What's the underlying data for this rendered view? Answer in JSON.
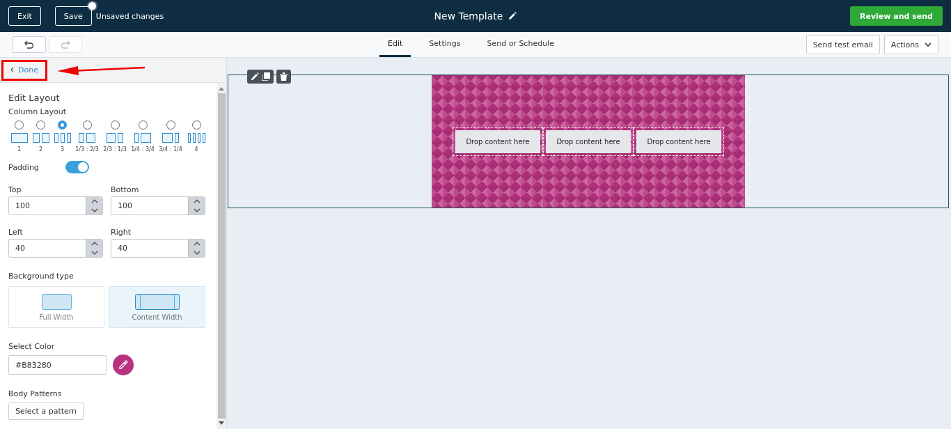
{
  "header": {
    "exit": "Exit",
    "save": "Save",
    "unsaved": true,
    "status": "Unsaved changes",
    "title": "New Template",
    "review": "Review and send"
  },
  "toolbar": {
    "undo": {
      "disabled": false
    },
    "redo": {
      "disabled": true
    },
    "tabs": [
      {
        "label": "Edit",
        "selected": true
      },
      {
        "label": "Settings",
        "selected": false
      },
      {
        "label": "Send or Schedule",
        "selected": false
      }
    ],
    "send_test": "Send test email",
    "actions": "Actions"
  },
  "sidebar": {
    "done": {
      "label": "Done",
      "highlighted": true
    },
    "title": "Edit Layout",
    "column_layout_label": "Column Layout",
    "layouts": [
      {
        "label": "1",
        "kind": "one",
        "selected": false
      },
      {
        "label": "2",
        "kind": "two",
        "selected": false
      },
      {
        "label": "3",
        "kind": "three",
        "selected": true
      },
      {
        "label": "1/3 : 2/3",
        "kind": "third-twothirds",
        "selected": false
      },
      {
        "label": "2/3 : 1/3",
        "kind": "twothirds-third",
        "selected": false
      },
      {
        "label": "1/4 : 3/4",
        "kind": "quarter-threequarters",
        "selected": false
      },
      {
        "label": "3/4 : 1/4",
        "kind": "threequarters-quarter",
        "selected": false
      },
      {
        "label": "4",
        "kind": "four",
        "selected": false
      }
    ],
    "padding": {
      "label": "Padding",
      "on": true
    },
    "fields": [
      {
        "label": "Top",
        "value": "100"
      },
      {
        "label": "Bottom",
        "value": "100"
      },
      {
        "label": "Left",
        "value": "40"
      },
      {
        "label": "Right",
        "value": "40"
      }
    ],
    "background_type": {
      "label": "Background type",
      "options": [
        {
          "label": "Full Width",
          "kind": "full",
          "selected": false
        },
        {
          "label": "Content Width",
          "kind": "content",
          "selected": true
        }
      ]
    },
    "color": {
      "label": "Select Color",
      "value": "#B83280"
    },
    "patterns": {
      "label": "Body Patterns",
      "button": "Select a pattern"
    }
  },
  "canvas": {
    "drop_zones": [
      "Drop content here",
      "Drop content here",
      "Drop content here"
    ]
  }
}
